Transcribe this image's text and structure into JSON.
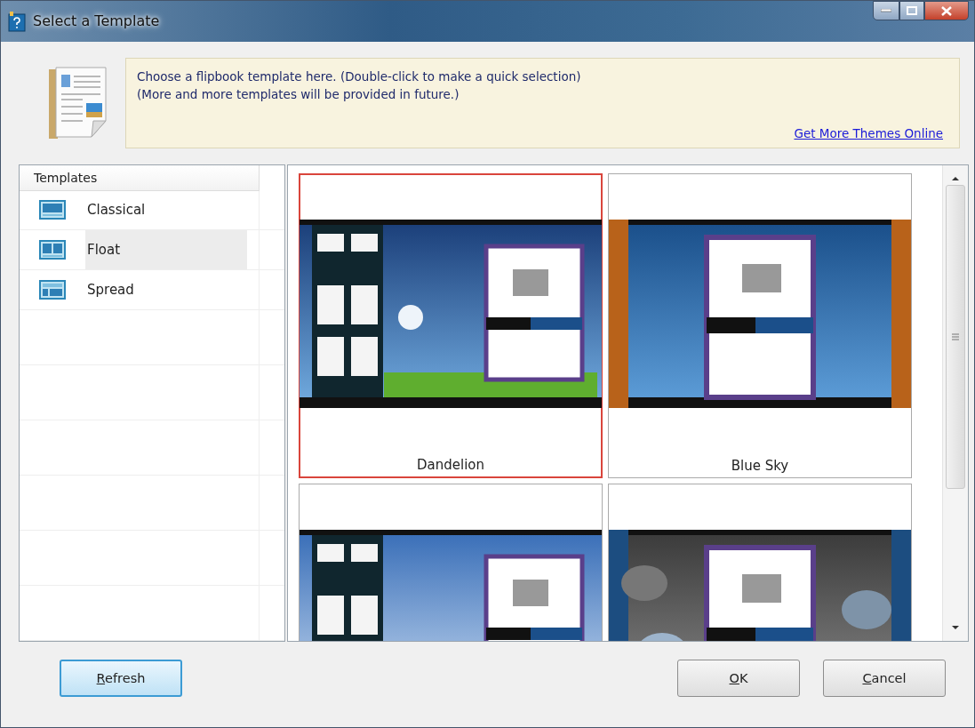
{
  "window": {
    "title": "Select a Template"
  },
  "info": {
    "lines": [
      "Choose a flipbook template here. (Double-click to make a quick selection)",
      "(More and more templates will be provided in future.)"
    ],
    "link": "Get More Themes Online"
  },
  "sidebar": {
    "header": "Templates",
    "items": [
      {
        "label": "Classical",
        "kind": "classical",
        "selected": false
      },
      {
        "label": "Float",
        "kind": "float",
        "selected": true
      },
      {
        "label": "Spread",
        "kind": "spread",
        "selected": false
      }
    ]
  },
  "templates": [
    {
      "name": "Dandelion",
      "kind": "float-grass",
      "selected": true
    },
    {
      "name": "Blue Sky",
      "kind": "classical-wood",
      "selected": false
    },
    {
      "kind": "float-light",
      "selected": false
    },
    {
      "kind": "classical-stones",
      "selected": false
    }
  ],
  "buttons": [
    {
      "label": "Refresh",
      "mnemonic": true,
      "kind": "focused"
    },
    {
      "label": "OK",
      "mnemonic": true,
      "kind": "normal"
    },
    {
      "label": "Cancel",
      "mnemonic": true,
      "kind": "normal"
    }
  ]
}
